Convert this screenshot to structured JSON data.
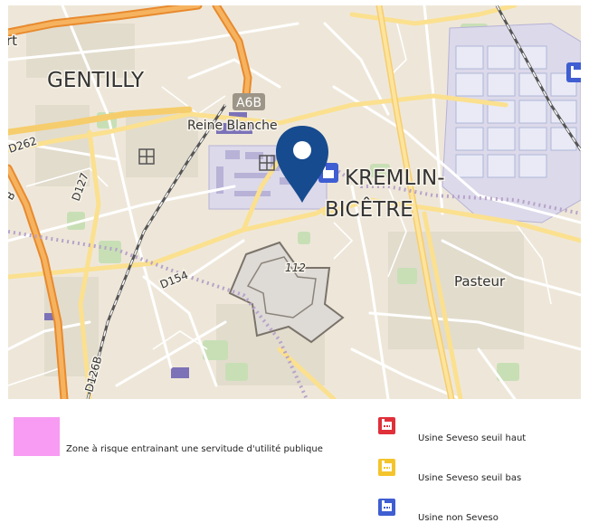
{
  "map": {
    "labels": {
      "gentilly": "GENTILLY",
      "kremlin": "KREMLIN-",
      "bicetre": "BICÊTRE",
      "reine_blanche": "Reine Blanche",
      "pasteur": "Pasteur",
      "a6b": "A6B",
      "d262": "D262",
      "d127": "D127",
      "d154": "D154",
      "d126b": "D126B",
      "n112": "112",
      "edge_left": "rt",
      "edge_left2": "B"
    },
    "colors": {
      "marker": "#174b8f",
      "highway": "#f0a74a",
      "major_road": "#fbe08f",
      "background": "#eee7d9"
    }
  },
  "legend": {
    "zone_label": "Zone à risque entrainant une servitude d'utilité publique",
    "zone_color": "#f79cf2",
    "items": [
      {
        "label": "Usine Seveso seuil haut",
        "color": "#e0303a",
        "icon": "factory-icon"
      },
      {
        "label": "Usine Seveso seuil bas",
        "color": "#f4c42c",
        "icon": "factory-icon"
      },
      {
        "label": "Usine non Seveso",
        "color": "#3f5ed2",
        "icon": "factory-icon"
      }
    ]
  }
}
